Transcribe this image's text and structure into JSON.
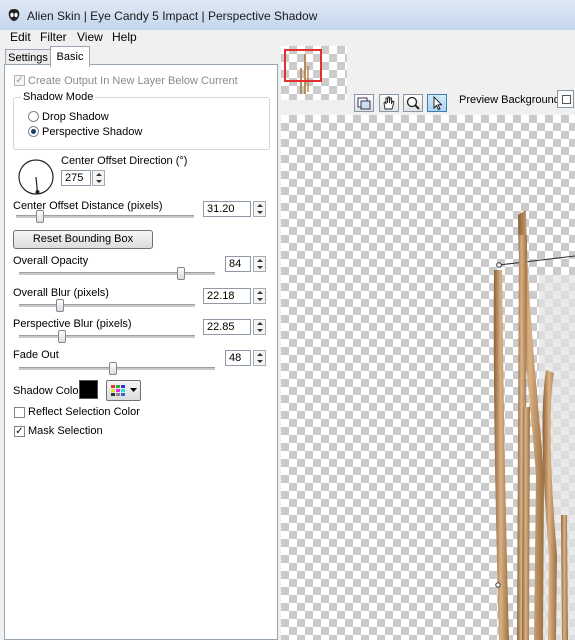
{
  "window": {
    "title": "Alien Skin | Eye Candy 5 Impact | Perspective Shadow",
    "app_icon": "alien-skin-logo-icon"
  },
  "menu": [
    "Edit",
    "Filter",
    "View",
    "Help"
  ],
  "tabs": {
    "settings": "Settings",
    "basic": "Basic",
    "active": "Basic"
  },
  "basic": {
    "create_output_label": "Create Output In New Layer Below Current",
    "create_output_checked": true,
    "create_output_enabled": false,
    "shadow_mode": {
      "title": "Shadow Mode",
      "options": [
        "Drop Shadow",
        "Perspective Shadow"
      ],
      "selected": "Perspective Shadow"
    },
    "center_offset_direction": {
      "label": "Center Offset Direction (°)",
      "value": "275"
    },
    "center_offset_distance": {
      "label": "Center Offset Distance (pixels)",
      "value": "31.20",
      "level": 0.12
    },
    "reset_button": "Reset Bounding Box",
    "overall_opacity": {
      "label": "Overall Opacity",
      "value": "84",
      "level": 0.84
    },
    "overall_blur": {
      "label": "Overall Blur (pixels)",
      "value": "22.18",
      "level": 0.22
    },
    "perspective_blur": {
      "label": "Perspective Blur (pixels)",
      "value": "22.85",
      "level": 0.23
    },
    "fade_out": {
      "label": "Fade Out",
      "value": "48",
      "level": 0.48
    },
    "shadow_color": {
      "label": "Shadow Color",
      "value": "#000000"
    },
    "reflect_selection_color": {
      "label": "Reflect Selection Color",
      "checked": false
    },
    "mask_selection": {
      "label": "Mask Selection",
      "checked": true
    }
  },
  "preview": {
    "background_label": "Preview Background:",
    "tools": [
      "preview-toggle-icon",
      "hand-icon",
      "zoom-icon",
      "arrow-icon"
    ],
    "active_tool": "arrow-icon"
  },
  "colors": {
    "title_bar": "#c4d6ec",
    "stick": "#c49a6c",
    "accent": "#3c7fb1"
  }
}
